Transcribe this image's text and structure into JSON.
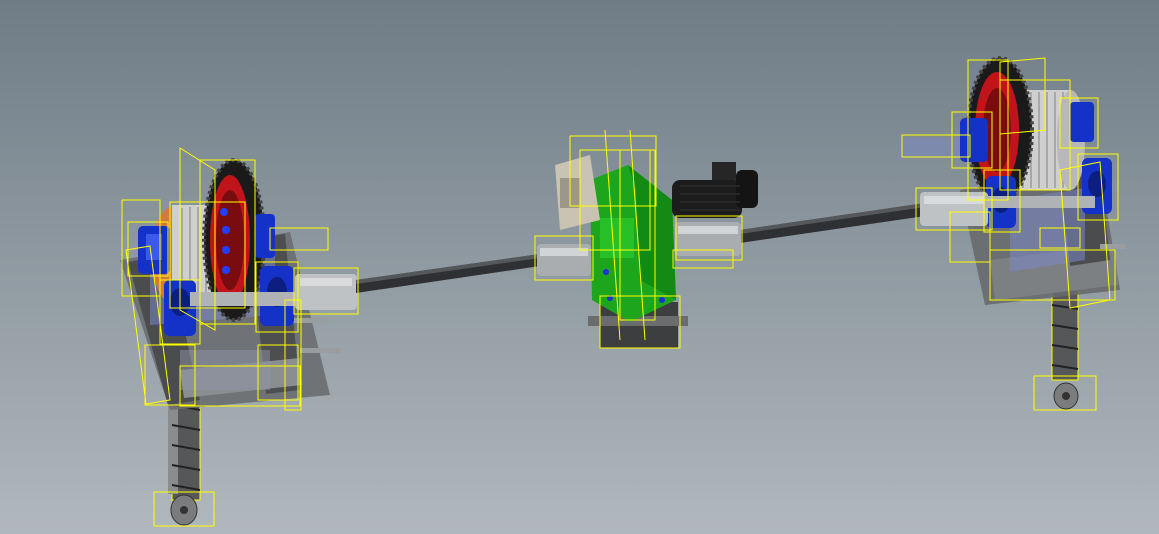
{
  "viewport": {
    "background_top": "#6f7c86",
    "background_bottom": "#b1b8bd"
  },
  "scene": {
    "components": [
      "drive-shaft",
      "gear-reducer",
      "electric-motor",
      "left-winch-drum",
      "right-winch-drum",
      "left-ring-gear",
      "right-ring-gear",
      "left-frame",
      "right-frame",
      "left-pillow-blocks",
      "right-pillow-blocks",
      "left-hanger-chain",
      "right-hanger-chain",
      "couplings"
    ],
    "colors": {
      "shaft": "#2e3033",
      "coupling": "#a9adb0",
      "gear_reducer": "#1ea51e",
      "motor": "#1c1c1c",
      "drum": "#c9c9c9",
      "drum_flange": "#cc7a3a",
      "ring_gear": "#1a1a1a",
      "ring_gear_hub": "#c0141a",
      "pillow_block": "#1432c8",
      "frame": "#585a5c",
      "selection_outline": "#ffff00"
    }
  }
}
